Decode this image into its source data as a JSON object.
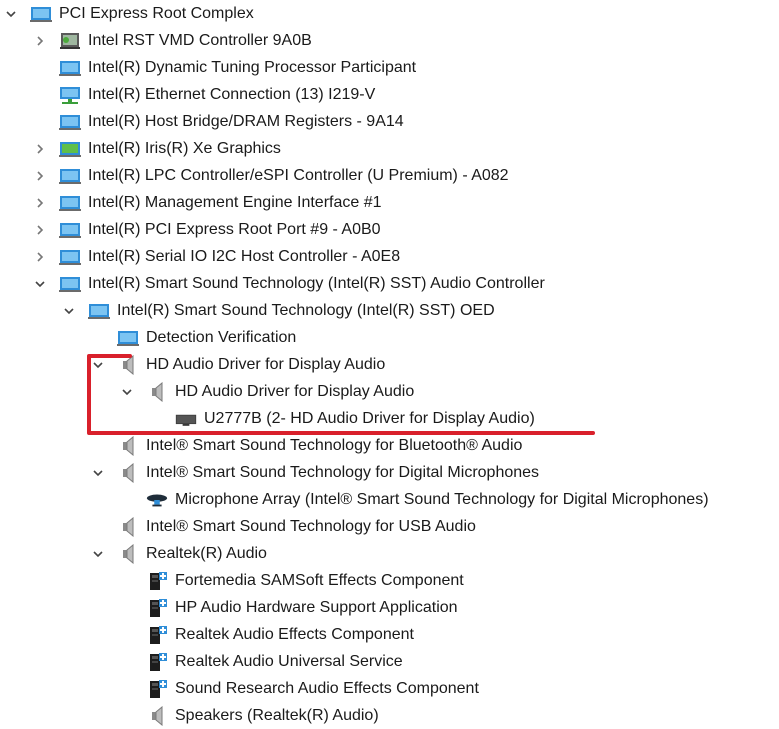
{
  "accent_color": "#d9202b",
  "tree": [
    {
      "label": "PCI Express Root Complex",
      "icon": "pci-device-icon",
      "expander": "expanded",
      "level": 0
    },
    {
      "label": "Intel RST VMD Controller 9A0B",
      "icon": "storage-controller-icon",
      "expander": "collapsed",
      "level": 1
    },
    {
      "label": "Intel(R) Dynamic Tuning Processor Participant",
      "icon": "system-device-icon",
      "expander": "none",
      "level": 1
    },
    {
      "label": "Intel(R) Ethernet Connection (13) I219-V",
      "icon": "network-adapter-icon",
      "expander": "none",
      "level": 1
    },
    {
      "label": "Intel(R) Host Bridge/DRAM Registers - 9A14",
      "icon": "system-device-icon",
      "expander": "none",
      "level": 1
    },
    {
      "label": "Intel(R) Iris(R) Xe Graphics",
      "icon": "display-adapter-icon",
      "expander": "collapsed",
      "level": 1
    },
    {
      "label": "Intel(R) LPC Controller/eSPI Controller (U Premium) - A082",
      "icon": "system-device-icon",
      "expander": "collapsed",
      "level": 1
    },
    {
      "label": "Intel(R) Management Engine Interface #1",
      "icon": "system-device-icon",
      "expander": "collapsed",
      "level": 1
    },
    {
      "label": "Intel(R) PCI Express Root Port #9 - A0B0",
      "icon": "system-device-icon",
      "expander": "collapsed",
      "level": 1
    },
    {
      "label": "Intel(R) Serial IO I2C Host Controller - A0E8",
      "icon": "system-device-icon",
      "expander": "collapsed",
      "level": 1
    },
    {
      "label": "Intel(R) Smart Sound Technology (Intel(R) SST) Audio Controller",
      "icon": "system-device-icon",
      "expander": "expanded",
      "level": 1
    },
    {
      "label": "Intel(R) Smart Sound Technology (Intel(R) SST) OED",
      "icon": "system-device-icon",
      "expander": "expanded",
      "level": 2
    },
    {
      "label": "Detection Verification",
      "icon": "system-device-icon",
      "expander": "none",
      "level": 3
    },
    {
      "label": "HD Audio Driver for Display Audio",
      "icon": "speaker-icon",
      "expander": "expanded",
      "level": 3
    },
    {
      "label": "HD Audio Driver for Display Audio",
      "icon": "speaker-icon",
      "expander": "expanded",
      "level": 4
    },
    {
      "label": "U2777B (2- HD Audio Driver for Display Audio)",
      "icon": "monitor-icon",
      "expander": "none",
      "level": 5
    },
    {
      "label": "Intel® Smart Sound Technology for Bluetooth® Audio",
      "icon": "speaker-icon",
      "expander": "none",
      "level": 3
    },
    {
      "label": "Intel® Smart Sound Technology for Digital Microphones",
      "icon": "speaker-icon",
      "expander": "expanded",
      "level": 3
    },
    {
      "label": "Microphone Array (Intel® Smart Sound Technology for Digital Microphones)",
      "icon": "microphone-icon",
      "expander": "none",
      "level": 4
    },
    {
      "label": "Intel® Smart Sound Technology for USB Audio",
      "icon": "speaker-icon",
      "expander": "none",
      "level": 3
    },
    {
      "label": "Realtek(R) Audio",
      "icon": "speaker-icon",
      "expander": "expanded",
      "level": 3
    },
    {
      "label": "Fortemedia SAMSoft Effects Component",
      "icon": "software-component-icon",
      "expander": "none",
      "level": 4
    },
    {
      "label": "HP Audio Hardware Support Application",
      "icon": "software-component-icon",
      "expander": "none",
      "level": 4
    },
    {
      "label": "Realtek Audio Effects Component",
      "icon": "software-component-icon",
      "expander": "none",
      "level": 4
    },
    {
      "label": "Realtek Audio Universal Service",
      "icon": "software-component-icon",
      "expander": "none",
      "level": 4
    },
    {
      "label": "Sound Research Audio Effects Component",
      "icon": "software-component-icon",
      "expander": "none",
      "level": 4
    },
    {
      "label": "Speakers (Realtek(R) Audio)",
      "icon": "speaker-icon",
      "expander": "none",
      "level": 4
    }
  ]
}
